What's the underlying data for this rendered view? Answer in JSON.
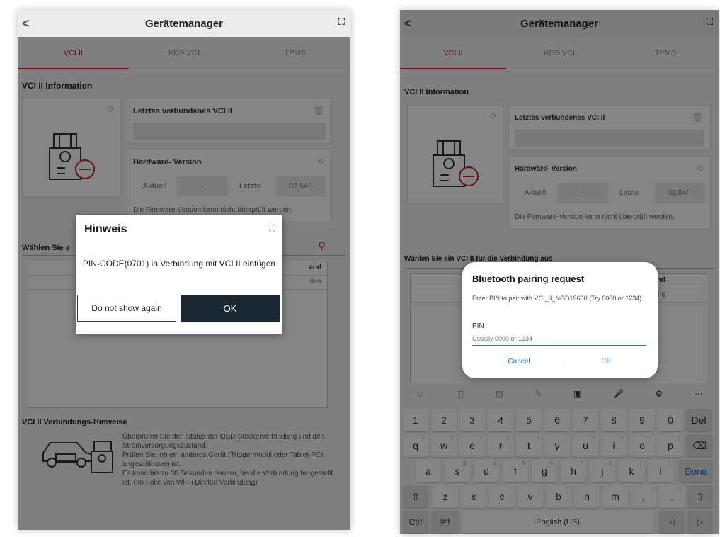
{
  "screen1": {
    "title": "Gerätemanager",
    "back": "<",
    "tabs": [
      "VCI II",
      "KDS VCI",
      "TPMS"
    ],
    "info_heading": "VCI II Information",
    "last_vci_title": "Letztes verbundenes VCI II",
    "hw_title": "Hardware- Version",
    "aktuell_label": "Aktuell",
    "aktuell_value": "-",
    "letzte_label": "Letzte",
    "letzte_value": "02.54/-",
    "fw_warning": "Die Firmware-Version kann nicht überprüft werden,",
    "select_heading_partial": "Wählen Sie e",
    "col_state_partial": "and",
    "state_partial": "den",
    "hints_heading": "VCI II Verbindungs-Hinweise",
    "hints_text": "Überprüfen Sie den Status der OBD-Steckerverbindung und den Stromversorgungszustand.\nPrüfen Sie, ob ein anderes Gerät (Triggermodul oder Tablet-PC) angeschlossen ist.\nEs kann bis zu 30 Sekunden dauern, bis die Verbindung hergestellt ist. (Im Falle von Wi-Fi Direkte Verbindung)",
    "dialog": {
      "title": "Hinweis",
      "message": "PIN-CODE(0701) in Verbindung mit VCI II einfügen",
      "btn_secondary": "Do not show again",
      "btn_primary": "OK"
    },
    "colors": {
      "accent": "#c0272d",
      "ok_button": "#1b2730"
    }
  },
  "screen2": {
    "title": "Gerätemanager",
    "back": "<",
    "tabs": [
      "VCI II",
      "KDS VCI",
      "TPMS"
    ],
    "info_heading": "VCI II Information",
    "last_vci_title": "Letztes verbundenes VCI II",
    "hw_title": "Hardware- Version",
    "aktuell_label": "Aktuell",
    "aktuell_value": "-",
    "letzte_label": "Letzte",
    "letzte_value": "02.54/-",
    "fw_warning": "Die Firmware-Version kann nicht überprüft werden.",
    "select_heading": "Wählen Sie ein VCI II für die Verbindung aus",
    "col_state_partial": "tand",
    "state_partial": "ecting",
    "bt_dialog": {
      "title": "Bluetooth pairing request",
      "message": "Enter PIN to pair with VCI_II_NGD19680 (Try 0000 or 1234).",
      "pin_label": "PIN",
      "pin_placeholder": "Usually 0000 or 1234",
      "cancel": "Cancel",
      "ok": "OK"
    },
    "keyboard": {
      "row1": [
        "1",
        "2",
        "3",
        "4",
        "5",
        "6",
        "7",
        "8",
        "9",
        "0",
        "Del"
      ],
      "row2": [
        "q",
        "w",
        "e",
        "r",
        "t",
        "y",
        "u",
        "i",
        "o",
        "p"
      ],
      "row2_sup": [
        "+",
        "×",
        "÷",
        "=",
        "/",
        "-",
        "<",
        ">",
        "[",
        "]"
      ],
      "row3": [
        "a",
        "s",
        "d",
        "f",
        "g",
        "h",
        "j",
        "k",
        "l"
      ],
      "row3_sup": [
        "!",
        "@",
        "#",
        "$",
        "%",
        "^",
        "&",
        "(",
        ")"
      ],
      "done": "Done",
      "row4": [
        "z",
        "x",
        "c",
        "v",
        "b",
        "n",
        "m",
        ",",
        "."
      ],
      "row4_sup": [
        "-",
        "'",
        "\"",
        ":",
        ";",
        "",
        "",
        "!",
        "?"
      ],
      "ctrl": "Ctrl",
      "symbols": "!#1",
      "language": "English (US)"
    },
    "colors": {
      "accent": "#c0272d",
      "link": "#1a73e8"
    }
  }
}
